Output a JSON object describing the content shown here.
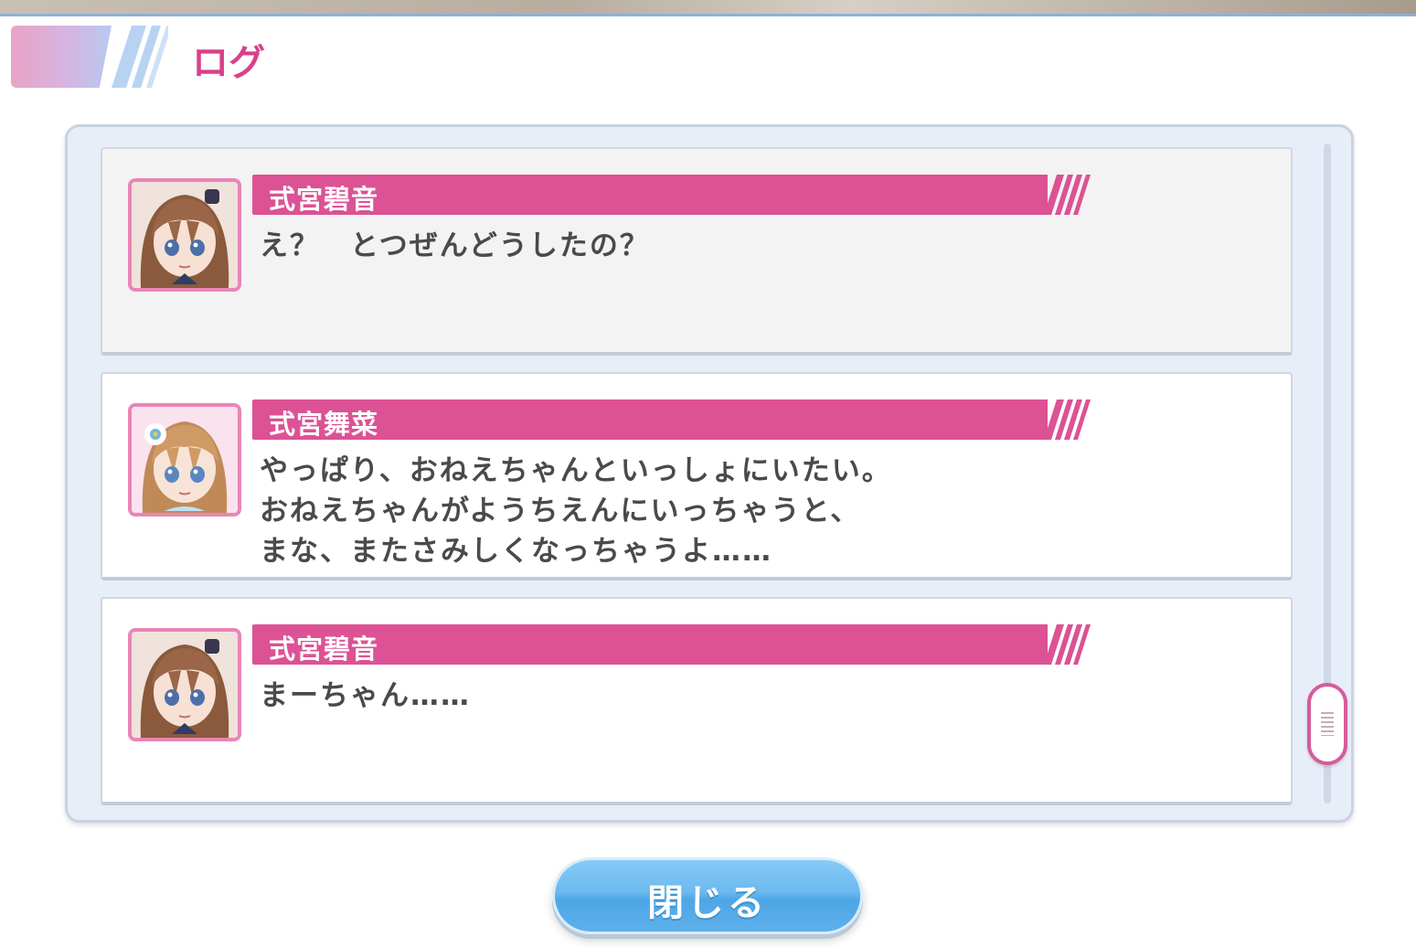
{
  "header": {
    "title": "ログ"
  },
  "log": {
    "entries": [
      {
        "speaker": "式宮碧音",
        "text": "え？　とつぜんどうしたの？",
        "avatar_icon": "character-portrait-akane-icon",
        "selected": true
      },
      {
        "speaker": "式宮舞菜",
        "text": "やっぱり、おねえちゃんといっしょにいたい。\nおねえちゃんがようちえんにいっちゃうと、\nまな、またさみしくなっちゃうよ……",
        "avatar_icon": "character-portrait-mana-icon",
        "selected": false
      },
      {
        "speaker": "式宮碧音",
        "text": "まーちゃん……",
        "avatar_icon": "character-portrait-akane-icon",
        "selected": false
      }
    ]
  },
  "close_button": {
    "label": "閉じる"
  },
  "colors": {
    "accent_pink": "#dc5294",
    "title_pink": "#d9418a",
    "button_blue": "#5eb0ea",
    "panel_bg": "#e8eef7"
  }
}
